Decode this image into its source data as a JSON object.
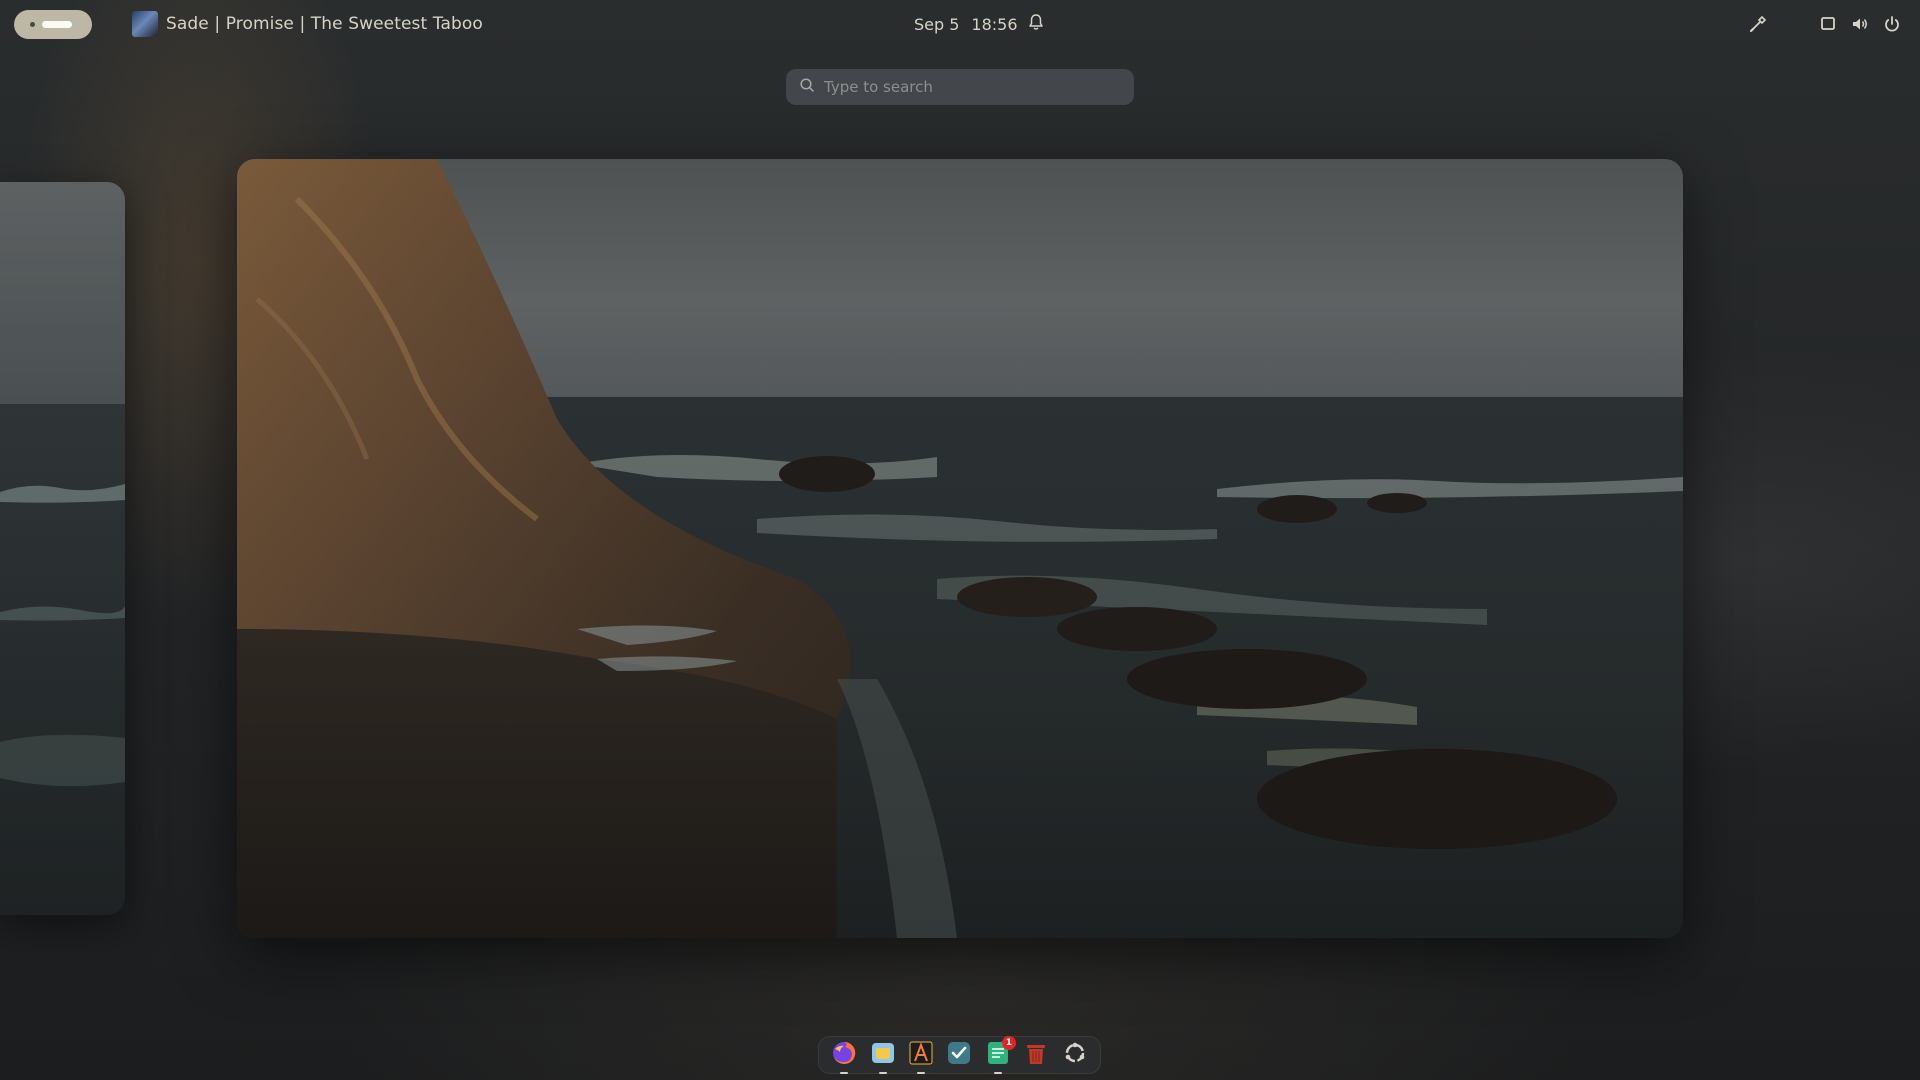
{
  "topbar": {
    "media_title": "Sade | Promise | The Sweetest Taboo",
    "clock_date": "Sep 5",
    "clock_time": "18:56"
  },
  "search": {
    "placeholder": "Type to search"
  },
  "dock": {
    "apps": [
      {
        "name": "Firefox",
        "icon": "firefox-icon",
        "running": true
      },
      {
        "name": "Files",
        "icon": "files-icon",
        "running": true
      },
      {
        "name": "Text Editor",
        "icon": "text-editor-icon",
        "running": true
      },
      {
        "name": "Tasks",
        "icon": "tasks-icon",
        "running": false
      },
      {
        "name": "Notes",
        "icon": "notes-icon",
        "running": true,
        "badge": "1"
      },
      {
        "name": "Trash",
        "icon": "trash-icon",
        "running": false
      },
      {
        "name": "Show Apps",
        "icon": "app-grid-icon",
        "running": false
      }
    ]
  },
  "colors": {
    "activities_pill": "#bdb8a6",
    "search_bg": "#43464a",
    "dock_bg": "#2b2c2d",
    "badge": "#e0242a"
  }
}
